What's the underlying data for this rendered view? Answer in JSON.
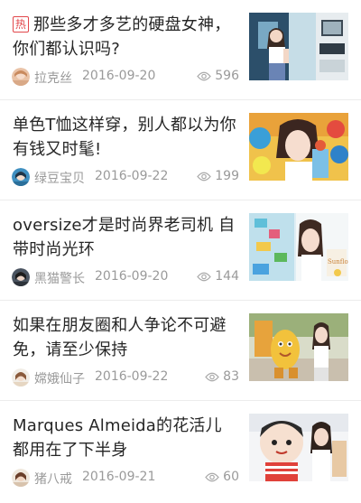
{
  "feed": {
    "hot_label": "热",
    "items": [
      {
        "title": "那些多才多艺的硬盘女神，你们都认识吗?",
        "author": "拉克丝",
        "date": "2016-09-20",
        "views": "596",
        "hot": true
      },
      {
        "title": "单色T恤这样穿，别人都以为你有钱又时髦!",
        "author": "绿豆宝贝",
        "date": "2016-09-22",
        "views": "199"
      },
      {
        "title": "oversize才是时尚界老司机 自带时尚光环",
        "author": "黑猫警长",
        "date": "2016-09-20",
        "views": "144"
      },
      {
        "title": "如果在朋友圈和人争论不可避免，请至少保持",
        "author": "嫦娥仙子",
        "date": "2016-09-22",
        "views": "83"
      },
      {
        "title": "Marques Almeida的花活儿都用在了下半身",
        "author": "猪八戒",
        "date": "2016-09-21",
        "views": "60"
      }
    ]
  },
  "thumb_texts": {
    "item3_sign": "Sunflowers"
  },
  "colors": {
    "hot": "#e2474b",
    "meta": "#9a9a9a",
    "title": "#262626",
    "divider": "#ececec"
  }
}
